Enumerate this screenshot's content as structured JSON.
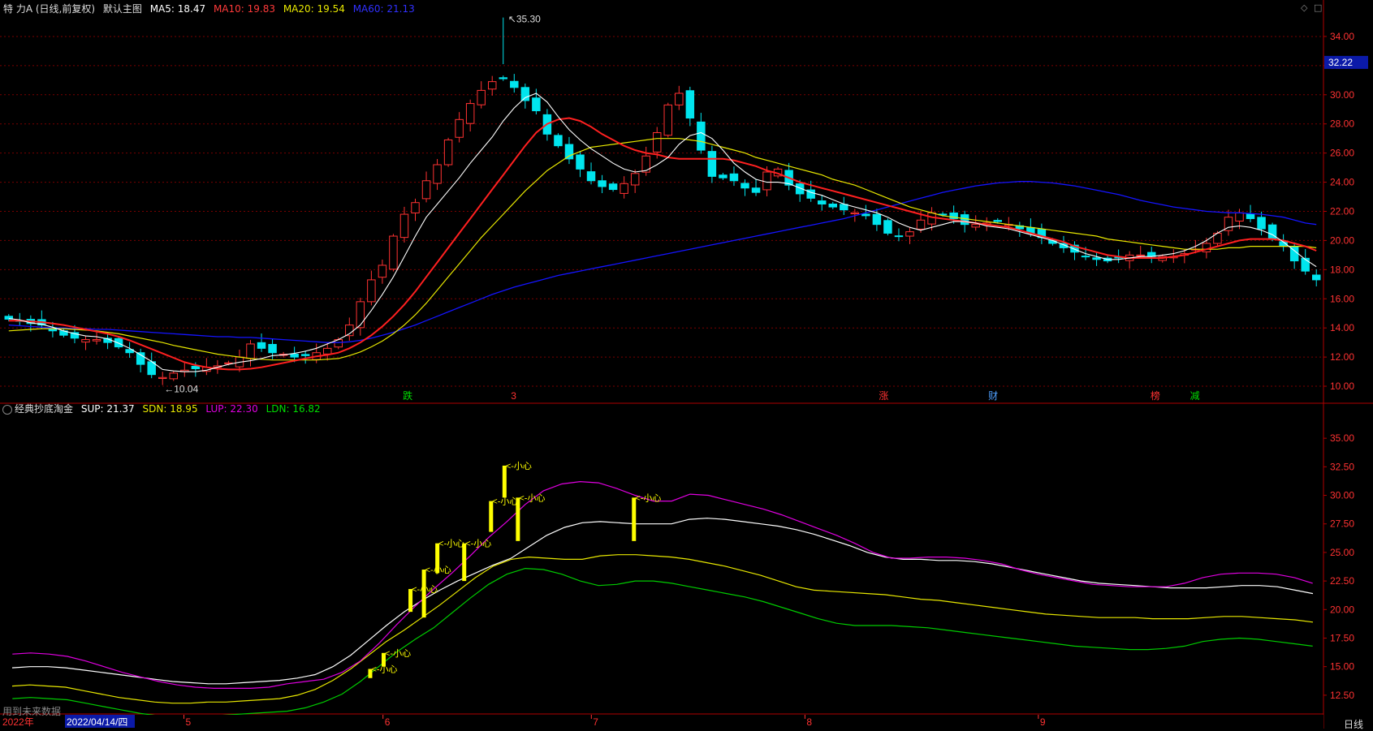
{
  "colors": {
    "up": "#ff3232",
    "down": "#00e5ee",
    "ma5": "#ffffff",
    "ma10": "#ff2020",
    "ma20": "#e8e800",
    "ma60": "#1414ff",
    "grid": "#7a0000",
    "sup": "#ffffff",
    "sdn": "#e8e800",
    "lup": "#e000e0",
    "ldn": "#00cc00",
    "signal": "#ffff00"
  },
  "main_header": {
    "title": "特 力A (日线,前复权)",
    "indicator": "默认主图",
    "ma5": "MA5: 18.47",
    "ma10": "MA10: 19.83",
    "ma20": "MA20: 19.54",
    "ma60": "MA60: 21.13"
  },
  "sub_header": {
    "indicator": "经典抄底淘金",
    "sup": "SUP: 21.37",
    "sdn": "SDN: 18.95",
    "lup": "LUP: 22.30",
    "ldn": "LDN: 16.82"
  },
  "price_labels": {
    "high": "35.30",
    "low": "10.04",
    "current": "32.22"
  },
  "footer": {
    "hint": "用到未来数据",
    "period": "日线",
    "year": "2022年",
    "date": "2022/04/14/四"
  },
  "months": [
    "5",
    "6",
    "7",
    "8",
    "9"
  ],
  "event_markers": [
    {
      "text": "跌",
      "color": "#00dd00"
    },
    {
      "text": "3",
      "color": "#ff3232"
    },
    {
      "text": "涨",
      "color": "#ff3232"
    },
    {
      "text": "财",
      "color": "#4fa0ff"
    },
    {
      "text": "榜",
      "color": "#ff3232"
    },
    {
      "text": "减",
      "color": "#00dd00"
    }
  ],
  "signal_label": "<-小心",
  "chart_data": [
    {
      "type": "candlestick",
      "title": "特 力A (日线,前复权)",
      "ylim": [
        9.0,
        35.5
      ],
      "y_ticks": [
        10,
        12,
        14,
        16,
        18,
        20,
        22,
        24,
        26,
        28,
        30,
        32,
        34
      ],
      "y_tick_labels": [
        "10.00",
        "12.00",
        "14.00",
        "16.00",
        "18.00",
        "20.00",
        "22.00",
        "24.00",
        "26.00",
        "28.00",
        "30.00",
        "32.00",
        "34.00"
      ],
      "close": [
        14.6,
        14.5,
        14.3,
        14.2,
        13.8,
        13.5,
        13.3,
        13.2,
        13.2,
        13.0,
        12.7,
        12.3,
        11.5,
        10.8,
        10.6,
        10.9,
        11.1,
        11.2,
        11.3,
        11.4,
        11.6,
        12.0,
        12.9,
        12.6,
        12.3,
        12.2,
        12.0,
        12.1,
        12.3,
        12.6,
        13.2,
        14.2,
        15.8,
        17.3,
        18.3,
        20.3,
        21.8,
        22.6,
        24.1,
        25.2,
        26.9,
        28.3,
        29.4,
        30.3,
        30.9,
        31.1,
        30.5,
        29.6,
        28.9,
        27.3,
        26.5,
        25.6,
        24.9,
        24.1,
        23.7,
        23.5,
        23.9,
        24.6,
        25.8,
        27.4,
        29.3,
        30.1,
        28.4,
        26.2,
        24.4,
        24.3,
        24.1,
        23.6,
        23.3,
        24.7,
        24.9,
        23.8,
        23.2,
        22.9,
        22.5,
        22.3,
        22.1,
        21.9,
        21.7,
        21.1,
        20.5,
        20.3,
        20.6,
        21.4,
        21.9,
        21.8,
        21.5,
        21.1,
        21.1,
        21.2,
        21.3,
        21.1,
        20.8,
        20.5,
        20.2,
        19.8,
        19.5,
        19.2,
        18.9,
        18.7,
        18.6,
        18.8,
        19.0,
        19.0,
        18.9,
        18.9,
        18.9,
        19.1,
        19.4,
        19.8,
        20.5,
        21.6,
        21.9,
        21.5,
        20.8,
        20.1,
        19.6,
        18.6,
        17.9,
        17.3
      ],
      "ma5": [
        14.65,
        14.55,
        14.35,
        14.25,
        14.05,
        13.8,
        13.6,
        13.45,
        13.4,
        13.25,
        12.95,
        12.6,
        12.15,
        11.7,
        11.15,
        11.05,
        11.0,
        11.0,
        11.1,
        11.3,
        11.5,
        11.65,
        11.75,
        11.9,
        12.1,
        12.15,
        12.25,
        12.4,
        12.6,
        12.9,
        13.2,
        13.6,
        14.2,
        15.2,
        16.3,
        17.5,
        18.9,
        20.3,
        21.6,
        22.5,
        23.4,
        24.3,
        25.3,
        26.2,
        27.1,
        28.2,
        29.1,
        29.8,
        30.1,
        29.5,
        28.5,
        27.6,
        26.9,
        26.3,
        25.8,
        25.3,
        24.9,
        24.7,
        24.8,
        25.2,
        25.7,
        26.6,
        27.2,
        27.4,
        27.0,
        26.2,
        25.3,
        24.7,
        24.2,
        24.0,
        24.0,
        23.9,
        23.6,
        23.3,
        23.1,
        22.8,
        22.5,
        22.3,
        22.1,
        21.9,
        21.6,
        21.2,
        20.9,
        20.7,
        20.9,
        21.1,
        21.3,
        21.3,
        21.2,
        21.0,
        20.9,
        20.8,
        20.6,
        20.4,
        20.2,
        20.0,
        19.7,
        19.4,
        19.1,
        18.9,
        18.7,
        18.7,
        18.8,
        18.9,
        18.9,
        19.0,
        19.1,
        19.3,
        19.6,
        20.0,
        20.5,
        20.9,
        21.0,
        20.9,
        20.7,
        20.4,
        19.9,
        19.3,
        18.7,
        18.2
      ],
      "ma10": [
        14.5,
        14.5,
        14.45,
        14.4,
        14.3,
        14.2,
        14.05,
        13.9,
        13.75,
        13.6,
        13.4,
        13.15,
        12.85,
        12.55,
        12.25,
        11.95,
        11.65,
        11.45,
        11.3,
        11.2,
        11.15,
        11.15,
        11.2,
        11.3,
        11.45,
        11.6,
        11.75,
        11.9,
        12.05,
        12.15,
        12.3,
        12.6,
        13.0,
        13.5,
        14.1,
        14.8,
        15.6,
        16.5,
        17.5,
        18.5,
        19.5,
        20.5,
        21.5,
        22.5,
        23.5,
        24.5,
        25.5,
        26.5,
        27.4,
        28.0,
        28.3,
        28.4,
        28.2,
        27.8,
        27.3,
        26.9,
        26.5,
        26.2,
        26.0,
        25.9,
        25.7,
        25.6,
        25.6,
        25.6,
        25.6,
        25.6,
        25.5,
        25.3,
        25.1,
        24.8,
        24.6,
        24.3,
        24.0,
        23.8,
        23.6,
        23.4,
        23.2,
        23.0,
        22.8,
        22.6,
        22.4,
        22.2,
        22.0,
        21.8,
        21.6,
        21.5,
        21.4,
        21.3,
        21.2,
        21.1,
        21.0,
        20.9,
        20.7,
        20.5,
        20.3,
        20.1,
        19.9,
        19.6,
        19.4,
        19.2,
        19.0,
        18.9,
        18.8,
        18.8,
        18.8,
        18.8,
        18.9,
        19.0,
        19.2,
        19.4,
        19.6,
        19.8,
        20.0,
        20.1,
        20.1,
        20.1,
        20.0,
        19.8,
        19.6,
        19.3
      ],
      "ma20": [
        13.8,
        13.85,
        13.9,
        13.95,
        13.95,
        13.95,
        13.9,
        13.85,
        13.8,
        13.7,
        13.6,
        13.45,
        13.3,
        13.15,
        13.0,
        12.8,
        12.65,
        12.5,
        12.35,
        12.2,
        12.1,
        12.0,
        11.9,
        11.85,
        11.8,
        11.8,
        11.8,
        11.8,
        11.8,
        11.85,
        11.9,
        12.1,
        12.35,
        12.7,
        13.1,
        13.6,
        14.2,
        14.9,
        15.7,
        16.6,
        17.5,
        18.4,
        19.3,
        20.2,
        21.0,
        21.8,
        22.6,
        23.4,
        24.1,
        24.8,
        25.3,
        25.8,
        26.1,
        26.4,
        26.5,
        26.6,
        26.7,
        26.8,
        26.9,
        27.0,
        27.0,
        27.0,
        26.9,
        26.8,
        26.6,
        26.4,
        26.2,
        26.0,
        25.7,
        25.5,
        25.3,
        25.1,
        24.9,
        24.7,
        24.5,
        24.2,
        24.0,
        23.8,
        23.5,
        23.2,
        22.9,
        22.6,
        22.3,
        22.1,
        21.9,
        21.7,
        21.6,
        21.5,
        21.4,
        21.3,
        21.2,
        21.1,
        21.0,
        20.9,
        20.8,
        20.7,
        20.6,
        20.5,
        20.4,
        20.3,
        20.1,
        20.0,
        19.9,
        19.8,
        19.7,
        19.6,
        19.5,
        19.4,
        19.4,
        19.4,
        19.4,
        19.5,
        19.5,
        19.6,
        19.6,
        19.6,
        19.6,
        19.6,
        19.6,
        19.5
      ],
      "ma60": [
        14.2,
        14.15,
        14.1,
        14.05,
        14.0,
        14.0,
        13.95,
        13.95,
        13.9,
        13.9,
        13.85,
        13.8,
        13.75,
        13.7,
        13.65,
        13.6,
        13.55,
        13.5,
        13.45,
        13.4,
        13.4,
        13.35,
        13.35,
        13.3,
        13.25,
        13.2,
        13.15,
        13.1,
        13.05,
        13.0,
        13.0,
        13.05,
        13.15,
        13.3,
        13.5,
        13.7,
        13.95,
        14.2,
        14.5,
        14.8,
        15.1,
        15.4,
        15.7,
        16.0,
        16.3,
        16.55,
        16.8,
        17.0,
        17.2,
        17.4,
        17.6,
        17.75,
        17.9,
        18.05,
        18.2,
        18.35,
        18.5,
        18.65,
        18.8,
        18.95,
        19.1,
        19.25,
        19.4,
        19.55,
        19.7,
        19.85,
        20.0,
        20.15,
        20.3,
        20.45,
        20.6,
        20.75,
        20.9,
        21.05,
        21.2,
        21.35,
        21.5,
        21.7,
        21.9,
        22.1,
        22.3,
        22.5,
        22.7,
        22.9,
        23.1,
        23.3,
        23.45,
        23.6,
        23.75,
        23.85,
        23.95,
        24.0,
        24.05,
        24.05,
        24.0,
        23.95,
        23.85,
        23.75,
        23.6,
        23.45,
        23.3,
        23.15,
        22.95,
        22.75,
        22.6,
        22.45,
        22.3,
        22.2,
        22.1,
        22.0,
        21.95,
        21.9,
        21.9,
        21.85,
        21.8,
        21.7,
        21.6,
        21.4,
        21.2,
        21.1
      ]
    },
    {
      "type": "line",
      "title": "经典抄底淘金",
      "ylim": [
        11.0,
        37.0
      ],
      "y_ticks": [
        12.5,
        15,
        17.5,
        20,
        22.5,
        25,
        27.5,
        30,
        32.5,
        35
      ],
      "y_tick_labels": [
        "12.50",
        "15.00",
        "17.50",
        "20.00",
        "22.50",
        "25.00",
        "27.50",
        "30.00",
        "32.50",
        "35.00"
      ],
      "series": [
        {
          "name": "SUP",
          "values": [
            14.9,
            15.0,
            15.0,
            14.9,
            14.7,
            14.5,
            14.3,
            14.1,
            13.9,
            13.7,
            13.6,
            13.5,
            13.5,
            13.6,
            13.7,
            13.8,
            14.0,
            14.3,
            15.0,
            16.0,
            17.3,
            18.6,
            19.8,
            20.8,
            21.7,
            22.5,
            23.2,
            23.9,
            24.5,
            25.5,
            26.5,
            27.2,
            27.6,
            27.7,
            27.6,
            27.5,
            27.5,
            27.5,
            27.9,
            28.0,
            27.9,
            27.7,
            27.5,
            27.3,
            27.0,
            26.6,
            26.1,
            25.6,
            25.0,
            24.6,
            24.4,
            24.4,
            24.3,
            24.3,
            24.2,
            24.0,
            23.7,
            23.4,
            23.1,
            22.8,
            22.5,
            22.3,
            22.2,
            22.1,
            22.0,
            21.9,
            21.9,
            21.9,
            22.0,
            22.1,
            22.1,
            22.0,
            21.7,
            21.4
          ]
        },
        {
          "name": "SDN",
          "values": [
            13.3,
            13.4,
            13.3,
            13.2,
            12.9,
            12.6,
            12.3,
            12.1,
            11.9,
            11.8,
            11.8,
            11.9,
            11.9,
            12.0,
            12.1,
            12.2,
            12.5,
            13.0,
            13.8,
            14.8,
            16.0,
            17.2,
            18.2,
            19.3,
            20.4,
            21.6,
            22.8,
            23.8,
            24.4,
            24.6,
            24.5,
            24.4,
            24.4,
            24.7,
            24.8,
            24.8,
            24.7,
            24.6,
            24.4,
            24.1,
            23.8,
            23.4,
            23.0,
            22.5,
            22.0,
            21.7,
            21.6,
            21.5,
            21.4,
            21.3,
            21.1,
            20.9,
            20.8,
            20.6,
            20.4,
            20.2,
            20.0,
            19.8,
            19.6,
            19.5,
            19.4,
            19.3,
            19.3,
            19.3,
            19.2,
            19.2,
            19.2,
            19.3,
            19.4,
            19.4,
            19.3,
            19.2,
            19.1,
            18.9
          ]
        },
        {
          "name": "LUP",
          "values": [
            16.1,
            16.2,
            16.1,
            15.9,
            15.5,
            15.0,
            14.5,
            14.1,
            13.7,
            13.4,
            13.2,
            13.1,
            13.1,
            13.1,
            13.2,
            13.5,
            13.7,
            13.9,
            14.5,
            15.5,
            17.0,
            18.7,
            20.3,
            21.8,
            23.2,
            24.7,
            26.3,
            27.7,
            29.2,
            30.4,
            31.0,
            31.2,
            31.1,
            30.6,
            30.0,
            29.5,
            29.5,
            30.1,
            30.0,
            29.6,
            29.2,
            28.8,
            28.3,
            27.7,
            27.1,
            26.5,
            25.8,
            25.0,
            24.5,
            24.5,
            24.6,
            24.6,
            24.5,
            24.3,
            24.0,
            23.5,
            23.1,
            22.8,
            22.5,
            22.2,
            22.1,
            22.0,
            22.0,
            22.0,
            22.3,
            22.8,
            23.1,
            23.2,
            23.2,
            23.1,
            22.8,
            22.3
          ]
        },
        {
          "name": "LDN",
          "values": [
            12.2,
            12.3,
            12.2,
            12.1,
            11.8,
            11.5,
            11.2,
            10.9,
            10.7,
            10.6,
            10.6,
            10.7,
            10.8,
            10.9,
            11.0,
            11.1,
            11.4,
            11.9,
            12.6,
            13.7,
            15.0,
            16.3,
            17.4,
            18.4,
            19.7,
            21.0,
            22.2,
            23.1,
            23.6,
            23.5,
            23.1,
            22.5,
            22.1,
            22.2,
            22.5,
            22.5,
            22.3,
            22.0,
            21.7,
            21.4,
            21.1,
            20.7,
            20.2,
            19.7,
            19.2,
            18.8,
            18.6,
            18.6,
            18.6,
            18.5,
            18.4,
            18.2,
            18.0,
            17.8,
            17.6,
            17.4,
            17.2,
            17.0,
            16.8,
            16.7,
            16.6,
            16.5,
            16.5,
            16.6,
            16.8,
            17.2,
            17.4,
            17.5,
            17.4,
            17.2,
            17.0,
            16.8
          ]
        }
      ],
      "signals": [
        {
          "bar": 0,
          "low": 14.0,
          "high": 14.8
        },
        {
          "bar": 1,
          "low": 15.0,
          "high": 16.2
        },
        {
          "bar": 3,
          "low": 19.8,
          "high": 21.8
        },
        {
          "bar": 4,
          "low": 19.3,
          "high": 23.5
        },
        {
          "bar": 5,
          "low": 23.2,
          "high": 25.8
        },
        {
          "bar": 7,
          "low": 22.5,
          "high": 25.8
        },
        {
          "bar": 9,
          "low": 26.8,
          "high": 29.5
        },
        {
          "bar": 10,
          "low": 29.8,
          "high": 32.6
        },
        {
          "bar": 11,
          "low": 26.0,
          "high": 29.8
        }
      ]
    }
  ]
}
